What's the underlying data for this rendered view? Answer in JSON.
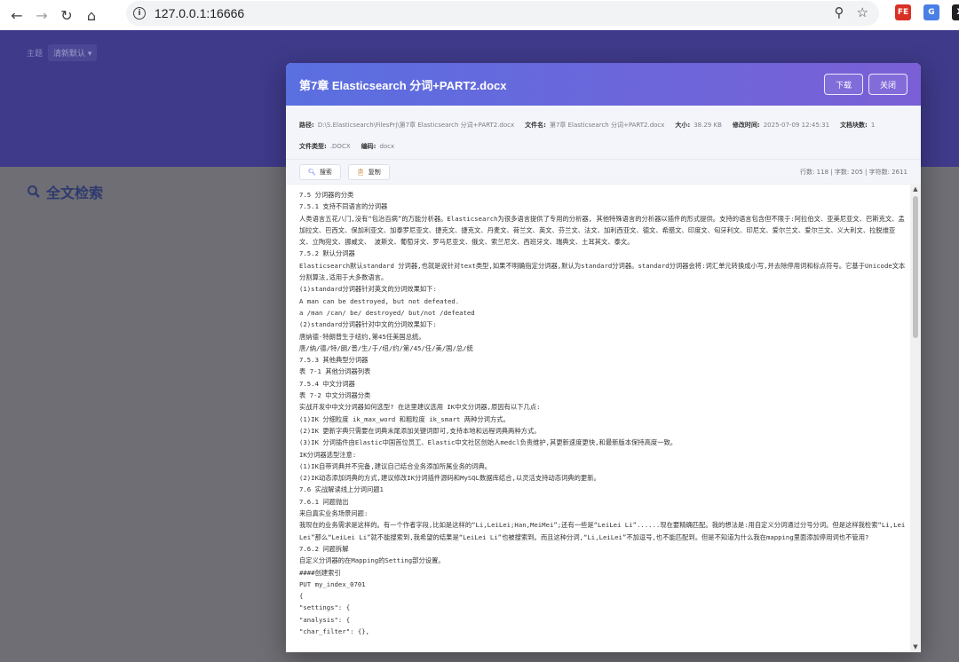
{
  "browser": {
    "url": "127.0.0.1:16666"
  },
  "app": {
    "theme_label": "主题",
    "theme_value": "清新默认 ▾",
    "search_title": "全文检索"
  },
  "modal": {
    "title": "第7章 Elasticsearch 分词+PART2.docx",
    "download_label": "下载",
    "close_label": "关闭",
    "meta": {
      "path_label": "路径:",
      "path_value": "D:\\S.Elasticsearch\\FilesPrj\\第7章 Elasticsearch 分词+PART2.docx",
      "filename_label": "文件名:",
      "filename_value": "第7章 Elasticsearch 分词+PART2.docx",
      "size_label": "大小:",
      "size_value": "38.29 KB",
      "mtime_label": "修改时间:",
      "mtime_value": "2025-07-09 12:45:31",
      "chunks_label": "文档块数:",
      "chunks_value": "1",
      "type_label": "文件类型:",
      "type_value": ".DOCX",
      "encoding_label": "编码:",
      "encoding_value": "docx"
    },
    "search_btn": "搜索",
    "copy_btn": "复制",
    "stats": "行数: 118 | 字数: 205 | 字符数: 2611",
    "lines": [
      "7.5 分词器的分类",
      "7.5.1 支持不同语言的分词器",
      "人类语言五花八门,没有“包治百病”的万能分析器。Elasticsearch为很多语言提供了专用的分析器, 其他特殊语言的分析器以插件的形式提供。支持的语言包含但不限于:阿拉伯文、亚美尼亚文、巴斯克文、孟加拉文、巴西文、保加利亚文、加泰罗尼亚文、捷克文、捷克文、丹麦文、荷兰文、英文、芬兰文、法文、加利西亚文、德文、希腊文、印度文、匈牙利文、印尼文、爱尔兰文、爱尔兰文、义大利文、拉脱维亚文、立陶宛文、挪威文、 波斯文、葡萄牙文、罗马尼亚文、俄文、索兰尼文、西班牙文、瑞典文、土耳其文、泰文。",
      "7.5.2 默认分词器",
      "Elasticsearch默认standard 分词器,也就是说针对text类型,如果不明确指定分词器,默认为standard分词器。standard分词器会将:词汇单元转换成小写,并去除停用词和标点符号。它基于Unicode文本分割算法,适用于大多数语言。",
      "(1)standard分词器针对英文的分词效果如下:",
      "A man can be destroyed, but not defeated.",
      "a /man /can/ be/ destroyed/ but/not /defeated",
      "(2)standard分词器针对中文的分词效果如下:",
      "唐纳德·特朗普生于纽约,第45任美国总统。",
      "唐/纳/德/特/朗/普/生/于/纽/约/第/45/任/美/国/总/统",
      "7.5.3 其他典型分词器",
      "表 7-1 其他分词器列表",
      "7.5.4 中文分词器",
      "表 7-2 中文分词器分类",
      "实战开发中中文分词器如何选型? 在这里建议选用 IK中文分词器,原因有以下几点:",
      "(1)IK 分细粒度 ik_max_word 和粗粒度 ik_smart 两种分词方式。",
      "(2)IK 更新字典只需要在词典末尾添加关键词即可,支持本地和远程词典两种方式。",
      "(3)IK 分词插件由Elastic中国首位员工、Elastic中文社区创始人medcl负责维护,其更新速度更快,和最新版本保持高度一致。",
      "IK分词器选型注意:",
      "(1)IK自带词典并不完备,建议自己结合业务添加所属业务的词典。",
      "(2)IK动态添加词典的方式,建议修改IK分词插件源码和MySQL数据库结合,以灵活支持动态词典的更新。",
      "7.6 实战解读线上分词问题1",
      "7.6.1 问题抛出",
      "来自真实业务场景问题:",
      "我现在的业务需求是这样的。有一个作者字段,比如是这样的“Li,LeiLei;Han,MeiMei”;还有一些是“LeiLei Li”......现在要精确匹配。我的想法是:用自定义分词通过分号分词。但是这样我检索“Li,LeiLei”那么“LeiLei Li”就不能搜索到,我希望的结果是“LeiLei Li”也被搜索到。而且这种分词,“Li,LeiLei”不加逗号,也不能匹配到。但是不知道为什么我在mapping里面添加停用词也不管用?",
      "7.6.2 问题拆解",
      "自定义分词器的在Mapping的Setting部分设置。",
      "####创建索引",
      "PUT my_index_0701",
      "{",
      "\"settings\": {",
      "\"analysis\": {",
      "\"char_filter\": {},"
    ]
  }
}
